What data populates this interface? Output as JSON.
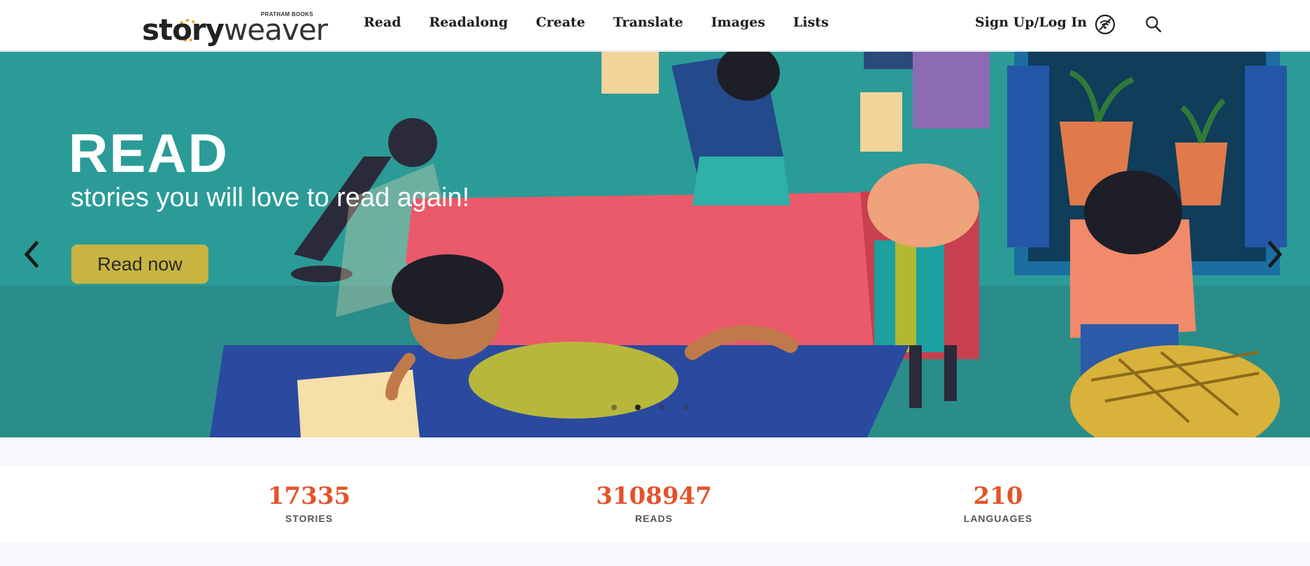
{
  "header": {
    "logo": {
      "publisher": "PRATHAM BOOKS",
      "name_bold": "story",
      "name_light": "weaver"
    },
    "nav": [
      "Read",
      "Readalong",
      "Create",
      "Translate",
      "Images",
      "Lists"
    ],
    "signup_label": "Sign Up/Log In",
    "icons": [
      "offline-library-icon",
      "search-icon"
    ]
  },
  "hero": {
    "title": "READ",
    "subtitle": "stories you will love to read again!",
    "button_label": "Read now",
    "slide_count": 4,
    "active_slide": 2
  },
  "stats": [
    {
      "value": "17335",
      "label": "STORIES"
    },
    {
      "value": "3108947",
      "label": "READS"
    },
    {
      "value": "210",
      "label": "LANGUAGES"
    }
  ],
  "colors": {
    "accent": "#e4532a",
    "button": "#c8b440",
    "hero_bg": "#2b9b98"
  }
}
